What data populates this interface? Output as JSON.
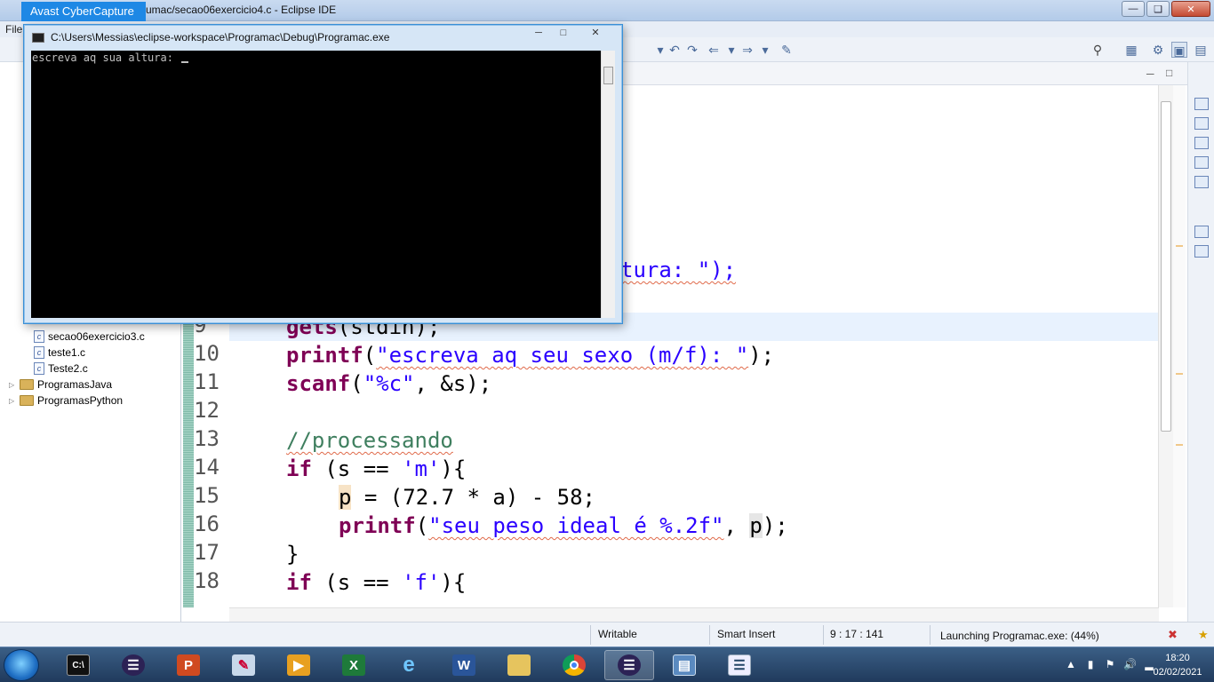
{
  "eclipse": {
    "window_title": "umac/secao06exercicio4.c - Eclipse IDE",
    "menu_first": "File",
    "status": {
      "writable": "Writable",
      "insert_mode": "Smart Insert",
      "position": "9 : 17 : 141",
      "launch": "Launching Programac.exe: (44%)"
    }
  },
  "avast": {
    "label": "Avast CyberCapture"
  },
  "console": {
    "title": "C:\\Users\\Messias\\eclipse-workspace\\Programac\\Debug\\Programac.exe",
    "output": "escreva aq sua altura: "
  },
  "explorer": {
    "items": [
      {
        "label": "secao06exercicio3.c",
        "type": "c-file"
      },
      {
        "label": "teste1.c",
        "type": "c-file"
      },
      {
        "label": "Teste2.c",
        "type": "c-file"
      },
      {
        "label": "ProgramasJava",
        "type": "project"
      },
      {
        "label": "ProgramasPython",
        "type": "project"
      }
    ]
  },
  "editor": {
    "line_numbers": [
      "9",
      "10",
      "11",
      "12",
      "13",
      "14",
      "15",
      "16",
      "17",
      "18"
    ],
    "partial_line_tail": "tura: \");",
    "lines": {
      "l9_fn": "gets",
      "l9_rest": "(stdin);",
      "l10_fn": "printf",
      "l10_str": "\"escreva aq seu sexo (m/f): \"",
      "l10_end": ");",
      "l11_fn": "scanf",
      "l11_str": "\"%c\"",
      "l11_end": ", &s);",
      "l13_cmt": "//processando",
      "l14_kw": "if",
      "l14_a": " (s == ",
      "l14_str": "'m'",
      "l14_end": "){",
      "l15_var": "p",
      "l15_rest": " = (72.7 * a) - 58;",
      "l16_fn": "printf",
      "l16_str": "\"seu peso ideal é %.2f\"",
      "l16_mid": ", ",
      "l16_var": "p",
      "l16_end": ");",
      "l17": "}",
      "l18_kw": "if",
      "l18_a": " (s == ",
      "l18_str": "'f'",
      "l18_end": "){"
    }
  },
  "taskbar": {
    "time": "18:20",
    "date": "02/02/2021",
    "apps": [
      "cmd",
      "eclipse",
      "powerpoint",
      "paint",
      "media-player",
      "excel",
      "internet-explorer",
      "word",
      "explorer",
      "chrome",
      "eclipse-active",
      "remote-desktop",
      "notepad"
    ]
  },
  "colors": {
    "keyword": "#7f0055",
    "string": "#2a00ff",
    "comment": "#3f7f5f",
    "avast_blue": "#1e88e5"
  }
}
